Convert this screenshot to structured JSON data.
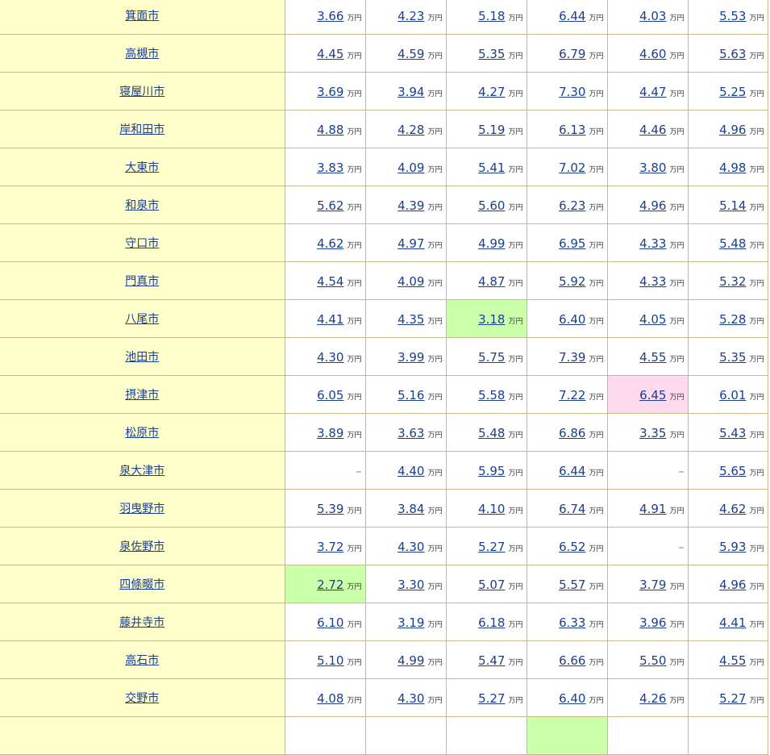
{
  "unit": "万円",
  "dash": "–",
  "highlight_colors": {
    "green": "#ccffaa",
    "pink": "#ffd9ee",
    "city_bg": "#ffffcc",
    "link": "#1a3f8f"
  },
  "rows": [
    {
      "city": "箕面市",
      "values": [
        "3.66",
        "4.23",
        "5.18",
        "6.44",
        "4.03",
        "5.53"
      ],
      "hl": [
        null,
        null,
        null,
        null,
        null,
        null
      ]
    },
    {
      "city": "高槻市",
      "values": [
        "4.45",
        "4.59",
        "5.35",
        "6.79",
        "4.60",
        "5.63"
      ],
      "hl": [
        null,
        null,
        null,
        null,
        null,
        null
      ]
    },
    {
      "city": "寝屋川市",
      "values": [
        "3.69",
        "3.94",
        "4.27",
        "7.30",
        "4.47",
        "5.25"
      ],
      "hl": [
        null,
        null,
        null,
        null,
        null,
        null
      ]
    },
    {
      "city": "岸和田市",
      "values": [
        "4.88",
        "4.28",
        "5.19",
        "6.13",
        "4.46",
        "4.96"
      ],
      "hl": [
        null,
        null,
        null,
        null,
        null,
        null
      ]
    },
    {
      "city": "大東市",
      "values": [
        "3.83",
        "4.09",
        "5.41",
        "7.02",
        "3.80",
        "4.98"
      ],
      "hl": [
        null,
        null,
        null,
        null,
        null,
        null
      ]
    },
    {
      "city": "和泉市",
      "values": [
        "5.62",
        "4.39",
        "5.60",
        "6.23",
        "4.96",
        "5.14"
      ],
      "hl": [
        null,
        null,
        null,
        null,
        null,
        null
      ]
    },
    {
      "city": "守口市",
      "values": [
        "4.62",
        "4.97",
        "4.99",
        "6.95",
        "4.33",
        "5.48"
      ],
      "hl": [
        null,
        null,
        null,
        null,
        null,
        null
      ]
    },
    {
      "city": "門真市",
      "values": [
        "4.54",
        "4.09",
        "4.87",
        "5.92",
        "4.33",
        "5.32"
      ],
      "hl": [
        null,
        null,
        null,
        null,
        null,
        null
      ]
    },
    {
      "city": "八尾市",
      "values": [
        "4.41",
        "4.35",
        "3.18",
        "6.40",
        "4.05",
        "5.28"
      ],
      "hl": [
        null,
        null,
        "green",
        null,
        null,
        null
      ]
    },
    {
      "city": "池田市",
      "values": [
        "4.30",
        "3.99",
        "5.75",
        "7.39",
        "4.55",
        "5.35"
      ],
      "hl": [
        null,
        null,
        null,
        null,
        null,
        null
      ]
    },
    {
      "city": "摂津市",
      "values": [
        "6.05",
        "5.16",
        "5.58",
        "7.22",
        "6.45",
        "6.01"
      ],
      "hl": [
        null,
        null,
        null,
        null,
        "pink",
        null
      ]
    },
    {
      "city": "松原市",
      "values": [
        "3.89",
        "3.63",
        "5.48",
        "6.86",
        "3.35",
        "5.43"
      ],
      "hl": [
        null,
        null,
        null,
        null,
        null,
        null
      ]
    },
    {
      "city": "泉大津市",
      "values": [
        null,
        "4.40",
        "5.95",
        "6.44",
        null,
        "5.65"
      ],
      "hl": [
        null,
        null,
        null,
        null,
        null,
        null
      ]
    },
    {
      "city": "羽曳野市",
      "values": [
        "5.39",
        "3.84",
        "4.10",
        "6.74",
        "4.91",
        "4.62"
      ],
      "hl": [
        null,
        null,
        null,
        null,
        null,
        null
      ]
    },
    {
      "city": "泉佐野市",
      "values": [
        "3.72",
        "4.30",
        "5.27",
        "6.52",
        null,
        "5.93"
      ],
      "hl": [
        null,
        null,
        null,
        null,
        null,
        null
      ]
    },
    {
      "city": "四條畷市",
      "values": [
        "2.72",
        "3.30",
        "5.07",
        "5.57",
        "3.79",
        "4.96"
      ],
      "hl": [
        "green",
        null,
        null,
        null,
        null,
        null
      ]
    },
    {
      "city": "藤井寺市",
      "values": [
        "6.10",
        "3.19",
        "6.18",
        "6.33",
        "3.96",
        "4.41"
      ],
      "hl": [
        null,
        null,
        null,
        null,
        null,
        null
      ]
    },
    {
      "city": "高石市",
      "values": [
        "5.10",
        "4.99",
        "5.47",
        "6.66",
        "5.50",
        "4.55"
      ],
      "hl": [
        null,
        null,
        null,
        null,
        null,
        null
      ]
    },
    {
      "city": "交野市",
      "values": [
        "4.08",
        "4.30",
        "5.27",
        "6.40",
        "4.26",
        "5.27"
      ],
      "hl": [
        null,
        null,
        null,
        null,
        null,
        null
      ]
    },
    {
      "city": "",
      "values": [
        null,
        null,
        null,
        null,
        null,
        null
      ],
      "blank": true,
      "hl": [
        null,
        null,
        null,
        "green",
        null,
        null
      ]
    }
  ]
}
